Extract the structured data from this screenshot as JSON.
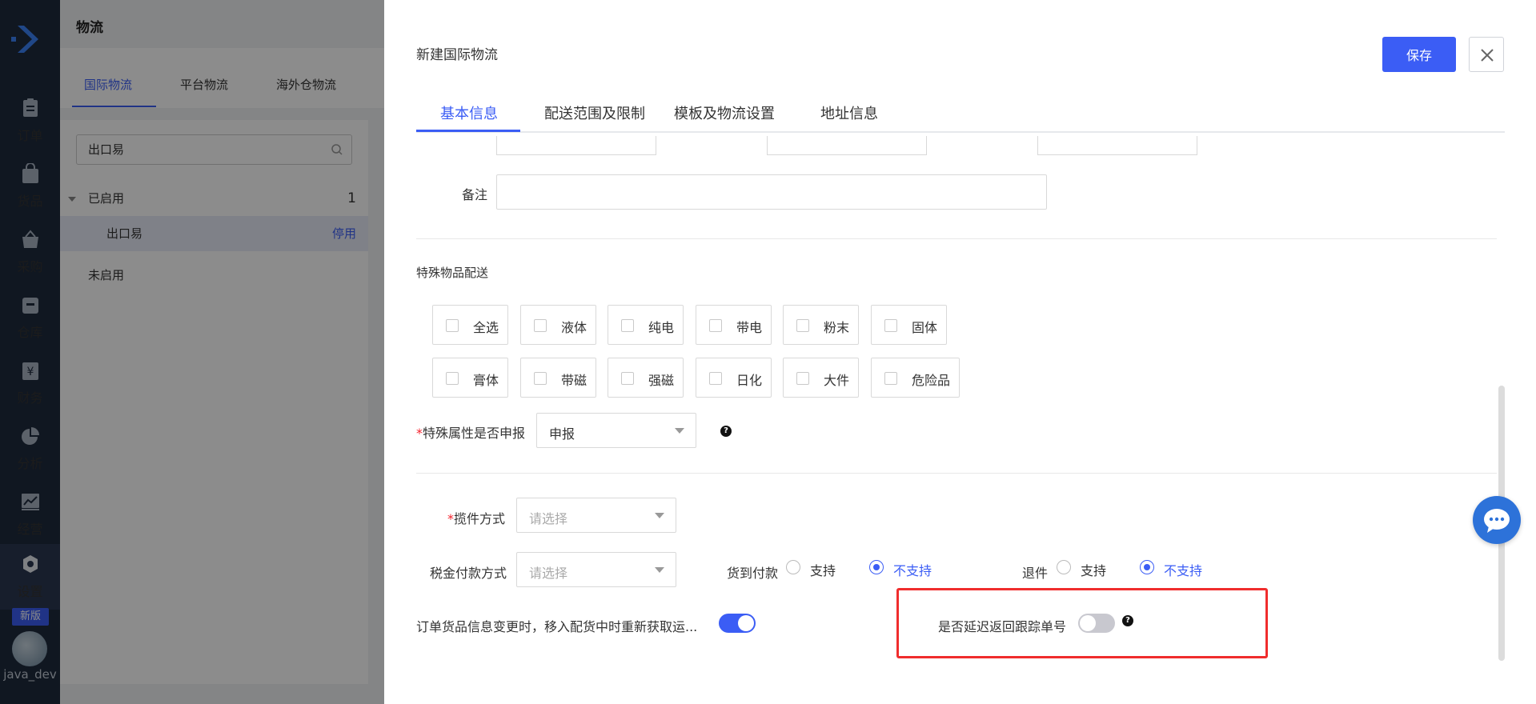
{
  "nav": {
    "items": [
      {
        "label": "订单",
        "icon": "order-icon"
      },
      {
        "label": "货品",
        "icon": "goods-bag-icon"
      },
      {
        "label": "采购",
        "icon": "basket-icon"
      },
      {
        "label": "仓库",
        "icon": "warehouse-icon"
      },
      {
        "label": "财务",
        "icon": "yen-icon"
      },
      {
        "label": "分析",
        "icon": "pie-chart-icon"
      },
      {
        "label": "经营",
        "icon": "trend-chart-icon"
      },
      {
        "label": "设置",
        "icon": "gear-icon"
      }
    ],
    "badge": "新版",
    "user": "java_dev"
  },
  "bg": {
    "title": "物流",
    "tabs": [
      "国际物流",
      "平台物流",
      "海外仓物流"
    ],
    "search_value": "出口易",
    "group_enabled": "已启用",
    "group_enabled_count": "1",
    "item_name": "出口易",
    "item_action": "停用",
    "group_disabled": "未启用"
  },
  "drawer": {
    "title": "新建国际物流",
    "save_label": "保存",
    "tabs": [
      "基本信息",
      "配送范围及限制",
      "模板及物流设置",
      "地址信息"
    ],
    "remark_label": "备注",
    "special_section": "特殊物品配送",
    "special_items_row1": [
      "全选",
      "液体",
      "纯电",
      "带电",
      "粉末",
      "固体"
    ],
    "special_items_row2": [
      "膏体",
      "带磁",
      "强磁",
      "日化",
      "大件",
      "危险品"
    ],
    "declare_label": "特殊属性是否申报",
    "declare_value": "申报",
    "pickup_label": "揽件方式",
    "placeholder": "请选择",
    "tax_label": "税金付款方式",
    "cod_label": "货到付款",
    "return_label": "退件",
    "support": "支持",
    "not_support": "不支持",
    "refetch_label": "订单货品信息变更时，移入配货中时重新获取运...",
    "delay_label": "是否延迟返回跟踪单号",
    "required_mark": "*",
    "help_mark": "?"
  }
}
